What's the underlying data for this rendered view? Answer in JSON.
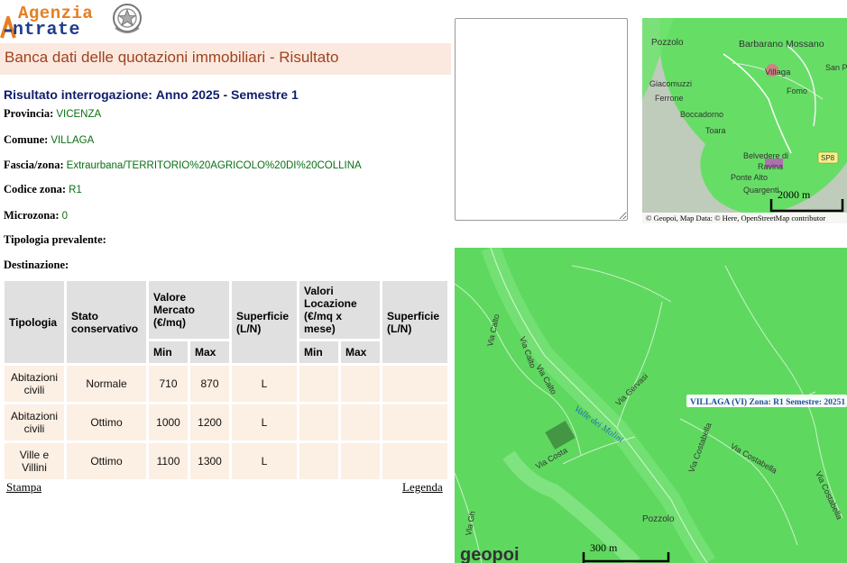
{
  "logo": {
    "line1": "Agenzia",
    "line2": "ntrate",
    "brand_color": "#1f3c8c",
    "accent_color": "#e67e22"
  },
  "title": "Banca dati delle quotazioni immobiliari - Risultato",
  "result": {
    "label": "Risultato interrogazione:",
    "period": "Anno 2025 - Semestre 1"
  },
  "fields": {
    "provincia": {
      "label": "Provincia:",
      "value": "VICENZA"
    },
    "comune": {
      "label": "Comune:",
      "value": "VILLAGA"
    },
    "fascia": {
      "label": "Fascia/zona:",
      "value": "Extraurbana/TERRITORIO%20AGRICOLO%20DI%20COLLINA"
    },
    "codice": {
      "label": "Codice zona:",
      "value": "R1"
    },
    "microzona": {
      "label": "Microzona:",
      "value": "0"
    },
    "tipologia": {
      "label": "Tipologia prevalente:",
      "value": ""
    },
    "destinazione": {
      "label": "Destinazione:",
      "value": ""
    }
  },
  "table": {
    "headers": {
      "tipologia": "Tipologia",
      "stato": "Stato conservativo",
      "valore_mercato": "Valore Mercato (€/mq)",
      "superficie1": "Superficie (L/N)",
      "valori_locazione": "Valori Locazione (€/mq x mese)",
      "superficie2": "Superficie (L/N)",
      "min": "Min",
      "max": "Max"
    },
    "rows": [
      {
        "tipologia": "Abitazioni civili",
        "stato": "Normale",
        "min": "710",
        "max": "870",
        "superficie": "L",
        "loc_min": "",
        "loc_max": "",
        "superficie2": ""
      },
      {
        "tipologia": "Abitazioni civili",
        "stato": "Ottimo",
        "min": "1000",
        "max": "1200",
        "superficie": "L",
        "loc_min": "",
        "loc_max": "",
        "superficie2": ""
      },
      {
        "tipologia": "Ville e Villini",
        "stato": "Ottimo",
        "min": "1100",
        "max": "1300",
        "superficie": "L",
        "loc_min": "",
        "loc_max": "",
        "superficie2": ""
      }
    ]
  },
  "links": {
    "stampa": "Stampa",
    "legenda": "Legenda"
  },
  "map_small": {
    "places": [
      "Pozzolo",
      "Barbarano Mossano",
      "Villaga",
      "San P",
      "Giacomuzzi",
      "Ferrone",
      "Fomo",
      "Boccadorno",
      "Toara",
      "Belvedere di",
      "Ravina",
      "Ponte Alto",
      "Quargenti"
    ],
    "road_badge": "SP8",
    "scale": "2000 m",
    "attribution": "© Geopoi, Map Data: © Here, OpenStreetMap contributor",
    "fill_color": "#5ee05e"
  },
  "map_big": {
    "streets": [
      "Via Calto",
      "Via Calto",
      "Via Calto",
      "Via Gervasi",
      "Valle dei Molini",
      "Via Costa",
      "Via Costabella",
      "Via Costabella",
      "Via Costabella",
      "Via Gh"
    ],
    "place": "Pozzolo",
    "zone_label": "VILLAGA (VI) Zona: R1 Semestre: 20251",
    "scale": "300 m",
    "brand": "geopoi",
    "fill_color": "#5fd85f"
  }
}
